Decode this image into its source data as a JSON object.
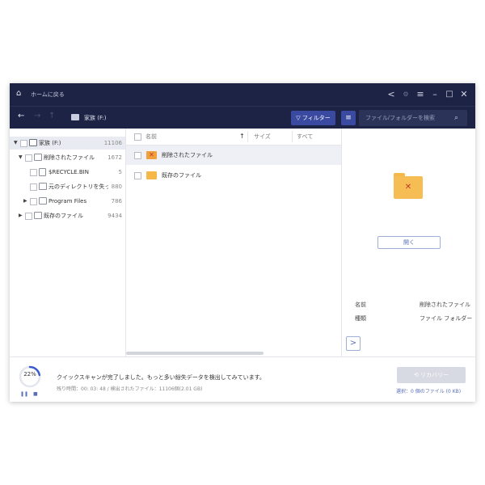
{
  "titlebar": {
    "back_home_label": "ホームに戻る",
    "icons": [
      "home-icon",
      "share-icon",
      "settings-icon",
      "menu-icon",
      "minimize-icon",
      "maximize-icon",
      "close-icon"
    ]
  },
  "toolbar": {
    "location": "家族 (F:)",
    "filter_label": "フィルター",
    "search_placeholder": "ファイル/フォルダーを検索"
  },
  "tree": [
    {
      "label": "家族 (F:)",
      "count": "11106"
    },
    {
      "label": "削除されたファイル",
      "count": "1672"
    },
    {
      "label": "$RECYCLE.BIN",
      "count": "5"
    },
    {
      "label": "元のディレクトリを失った…",
      "count": "880"
    },
    {
      "label": "Program Files",
      "count": "786"
    },
    {
      "label": "既存のファイル",
      "count": "9434"
    }
  ],
  "columns": {
    "name": "名前",
    "size": "サイズ",
    "all": "すべて"
  },
  "files": [
    {
      "name": "削除されたファイル"
    },
    {
      "name": "既存のファイル"
    }
  ],
  "preview": {
    "open_label": "開く",
    "name_key": "名前",
    "name_value": "削除されたファイル",
    "type_key": "種類",
    "type_value": "ファイル フォルダー"
  },
  "status": {
    "progress_percent": 22,
    "progress_label": "22%",
    "message": "クイックスキャンが完了しました。もっと多い紛失データを検出してみています。",
    "detail": "残り時間：00: 03: 48 / 検出されたファイル：11106個(2.01 GB)",
    "recover_label": "リカバリー",
    "selection_info": "選択：0 個のファイル (0 KB)"
  },
  "colors": {
    "titlebar": "#1d2345",
    "accent": "#3a4aa0",
    "folder": "#f5b94a"
  }
}
